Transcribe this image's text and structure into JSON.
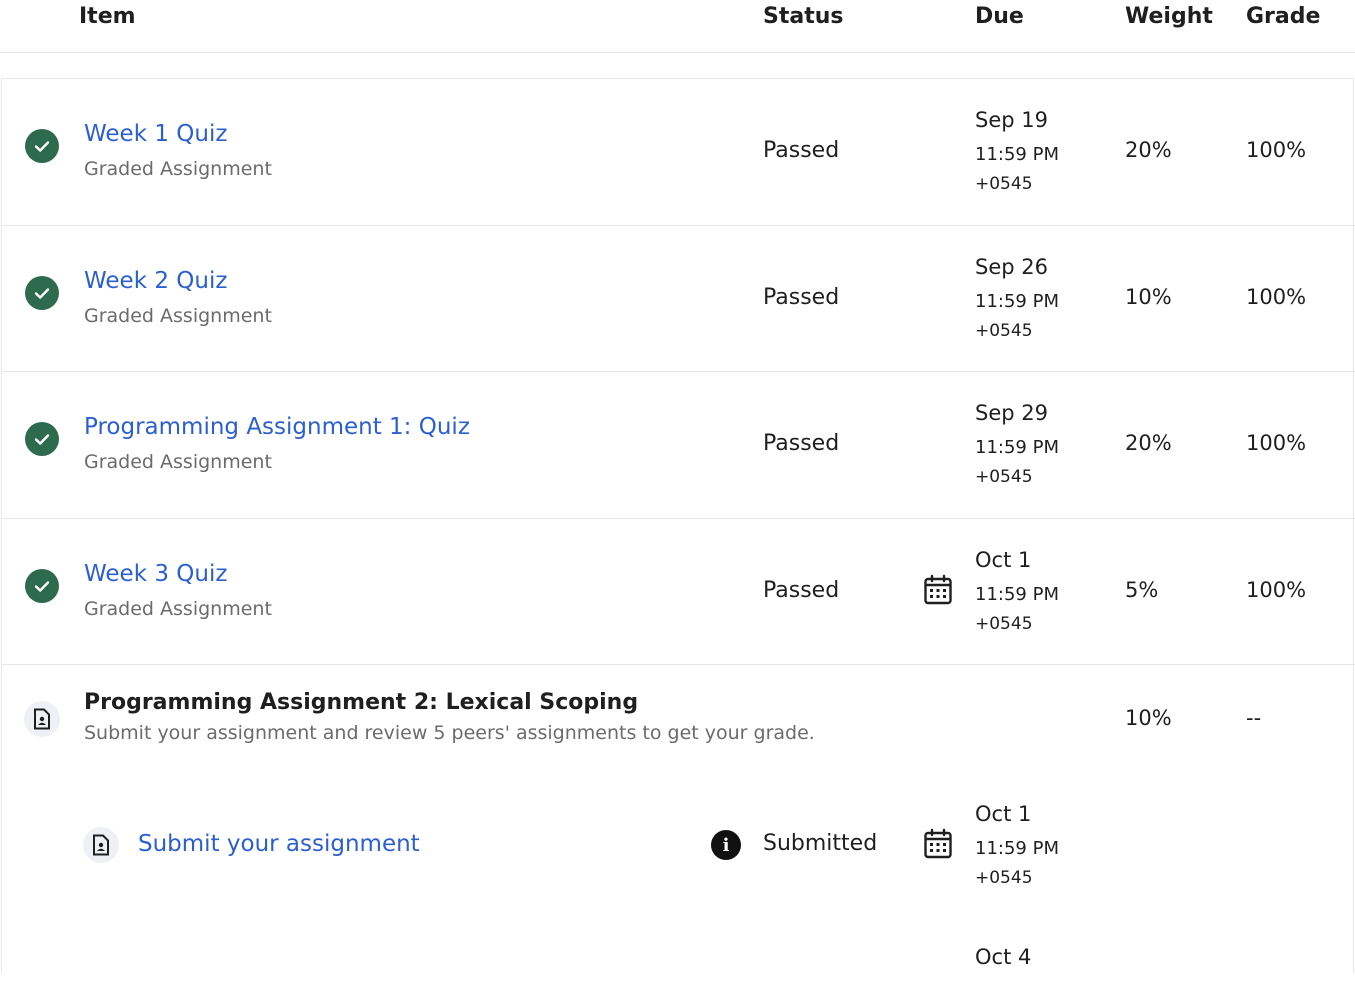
{
  "header": {
    "item": "Item",
    "status": "Status",
    "due": "Due",
    "weight": "Weight",
    "grade": "Grade"
  },
  "rows": [
    {
      "title": "Week 1 Quiz",
      "type": "Graded Assignment",
      "status": "Passed",
      "due_date": "Sep 19",
      "due_time": "11:59 PM",
      "due_tz": "+0545",
      "weight": "20%",
      "grade": "100%"
    },
    {
      "title": "Week 2 Quiz",
      "type": "Graded Assignment",
      "status": "Passed",
      "due_date": "Sep 26",
      "due_time": "11:59 PM",
      "due_tz": "+0545",
      "weight": "10%",
      "grade": "100%"
    },
    {
      "title": "Programming Assignment 1: Quiz",
      "type": "Graded Assignment",
      "status": "Passed",
      "due_date": "Sep 29",
      "due_time": "11:59 PM",
      "due_tz": "+0545",
      "weight": "20%",
      "grade": "100%"
    },
    {
      "title": "Week 3 Quiz",
      "type": "Graded Assignment",
      "status": "Passed",
      "due_date": "Oct 1",
      "due_time": "11:59 PM",
      "due_tz": "+0545",
      "weight": "5%",
      "grade": "100%"
    }
  ],
  "peer_assignment": {
    "title": "Programming Assignment 2: Lexical Scoping",
    "description": "Submit your assignment and review 5 peers' assignments to get your grade.",
    "weight": "10%",
    "grade": "--",
    "subtask": {
      "title": "Submit your assignment",
      "status": "Submitted",
      "due_date": "Oct 1",
      "due_time": "11:59 PM",
      "due_tz": "+0545"
    },
    "next_due_date": "Oct 4"
  },
  "icons": {
    "complete": "check-circle-icon",
    "calendar": "calendar-icon",
    "document": "document-icon",
    "info": "info-icon"
  },
  "colors": {
    "link": "#2b5fd0",
    "complete": "#2e6b4e",
    "muted": "#6b6b6b"
  }
}
